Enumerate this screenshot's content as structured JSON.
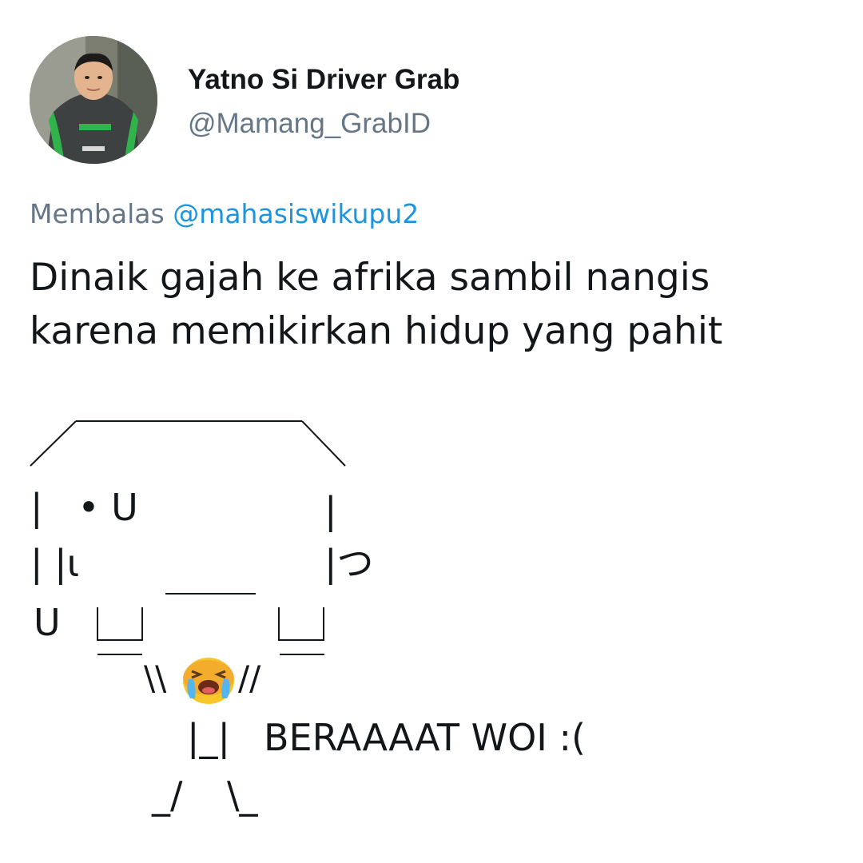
{
  "tweet": {
    "author": {
      "display_name": "Yatno Si Driver Grab",
      "handle": "@Mamang_GrabID",
      "avatar": "profile-photo"
    },
    "reply": {
      "prefix": "Membalas",
      "mention": "@mahasiswikupu2"
    },
    "text": "Dinaik gajah ke afrika sambil nangis karena memikirkan hidup yang pahit",
    "ascii_art": {
      "row1": "|   • U",
      "row1_right": "|",
      "row2": "| |ι",
      "row2_right": "|つ",
      "row3_left": "U",
      "row4_arms": "\\\\",
      "row4_arms_right": "//",
      "emoji": "crying-face-emoji",
      "row5_body": "|_|",
      "shout": "BERAAAAT WOI :(",
      "row6_legs_left": "_/",
      "row6_legs_right": "\\_"
    },
    "colors": {
      "text": "#14171a",
      "secondary": "#657786",
      "mention": "#1b95e0",
      "jacket_green": "#2fb34a"
    }
  }
}
